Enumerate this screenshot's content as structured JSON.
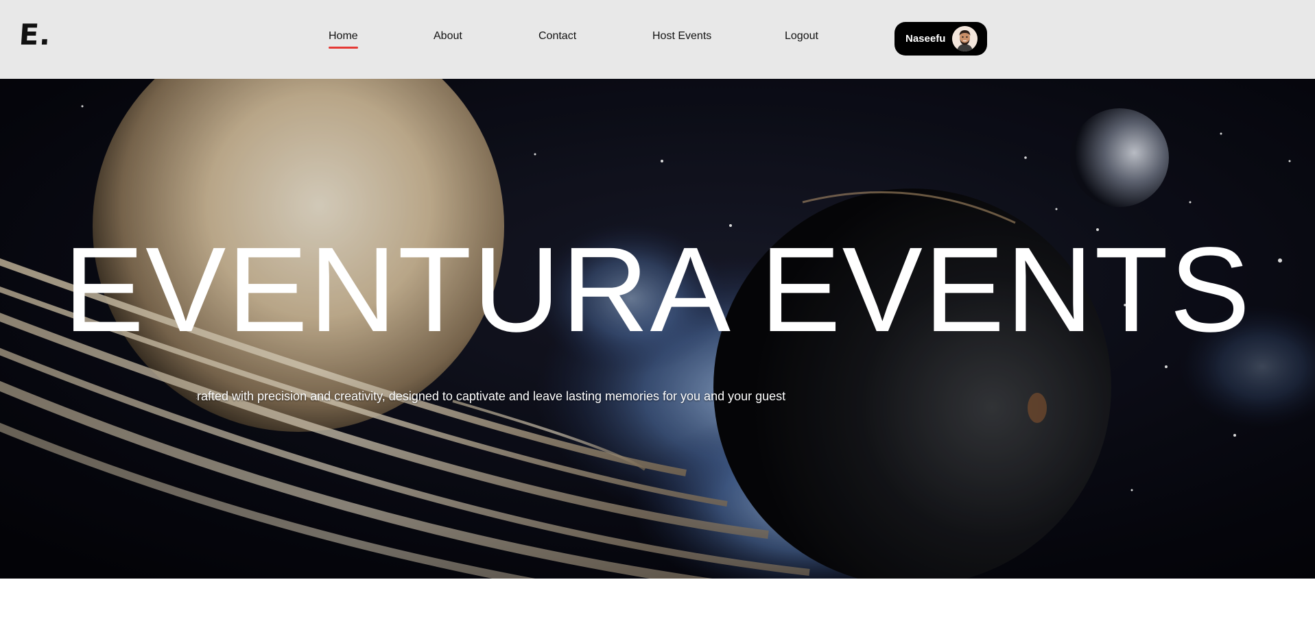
{
  "header": {
    "logo_text": "E.",
    "nav": [
      {
        "label": "Home",
        "active": true
      },
      {
        "label": "About",
        "active": false
      },
      {
        "label": "Contact",
        "active": false
      },
      {
        "label": "Host Events",
        "active": false
      },
      {
        "label": "Logout",
        "active": false
      }
    ],
    "user": {
      "name": "Naseefu",
      "avatar_icon": "user-avatar-icon"
    }
  },
  "hero": {
    "title": "EVENTURA EVENTS",
    "subtitle": "crafted with precision and creativity, designed to captivate and leave lasting memories for you and your guests",
    "background": "space scene with ringed planet, planets and blue nebula"
  },
  "colors": {
    "header_bg": "#e8e8e8",
    "active_underline": "#e53935",
    "pill_bg": "#000000",
    "hero_bg": "#06070d"
  }
}
